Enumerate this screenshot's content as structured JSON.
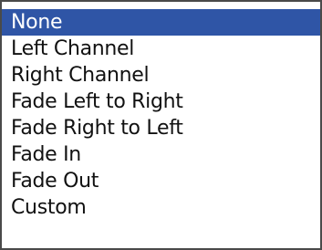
{
  "dropdown": {
    "selected_index": 0,
    "items": [
      {
        "label": "None"
      },
      {
        "label": "Left Channel"
      },
      {
        "label": "Right Channel"
      },
      {
        "label": "Fade Left to Right"
      },
      {
        "label": "Fade Right to Left"
      },
      {
        "label": "Fade In"
      },
      {
        "label": "Fade Out"
      },
      {
        "label": "Custom"
      }
    ]
  },
  "colors": {
    "selection": "#2f55a6",
    "text": "#111111",
    "background": "#ffffff",
    "border": "#4a4a4a"
  }
}
